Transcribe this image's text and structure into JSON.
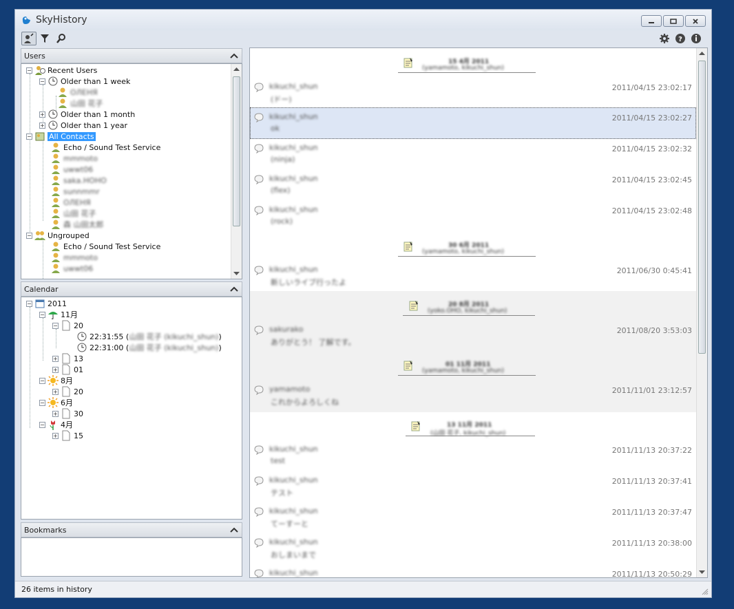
{
  "app": {
    "title": "SkyHistory"
  },
  "users_panel": {
    "title": "Users",
    "tree": {
      "recent": "Recent Users",
      "older_week": "Older than 1 week",
      "week_users": [
        "ОЛЕНЯ",
        "山田 花子"
      ],
      "older_month": "Older than 1 month",
      "older_year": "Older than 1 year",
      "all_contacts": "All Contacts",
      "contacts": [
        "Echo / Sound Test Service",
        "mmmoto",
        "uwwt06",
        "saka.HOHO",
        "sunnmmr",
        "ОЛЕНЯ",
        "山田 花子",
        "森 山田太郎"
      ],
      "ungrouped": "Ungrouped",
      "ungrouped_contacts": [
        "Echo / Sound Test Service",
        "mmmoto",
        "uwwt06"
      ]
    }
  },
  "calendar_panel": {
    "title": "Calendar",
    "year": "2011",
    "nov": "11月",
    "d20": "20",
    "t1": "22:31:55 (",
    "t1_blur": "山田 花子 (kikuchi_shun)",
    "t1_end": ")",
    "t2": "22:31:00 (",
    "t2_blur": "山田 花子 (kikuchi_shun)",
    "t2_end": ")",
    "d13": "13",
    "d01": "01",
    "aug": "8月",
    "aug20": "20",
    "jun": "6月",
    "jun30": "30",
    "apr": "4月",
    "apr15": "15"
  },
  "bookmarks_panel": {
    "title": "Bookmarks"
  },
  "status": {
    "text": "26 items in history"
  },
  "chat": {
    "sessions": [
      {
        "date": "15 4月 2011",
        "people": "(yamamoto, kikuchi_shun)"
      },
      {
        "date": "30 6月 2011",
        "people": "(yamamoto, kikuchi_shun)"
      },
      {
        "date": "20 8月 2011",
        "people": "(yoko.OHO, kikuchi_shun)"
      },
      {
        "date": "01 11月 2011",
        "people": "(yamamoto, kikuchi_shun)"
      },
      {
        "date": "13 11月 2011",
        "people": "(山田 花子, kikuchi_shun)"
      }
    ],
    "messages": [
      {
        "sender": "kikuchi_shun",
        "text": "(ドー)",
        "time": "2011/04/15 23:02:17"
      },
      {
        "sender": "kikuchi_shun",
        "text": "ok",
        "time": "2011/04/15 23:02:27"
      },
      {
        "sender": "kikuchi_shun",
        "text": "(ninja)",
        "time": "2011/04/15 23:02:32"
      },
      {
        "sender": "kikuchi_shun",
        "text": "(flex)",
        "time": "2011/04/15 23:02:45"
      },
      {
        "sender": "kikuchi_shun",
        "text": "(rock)",
        "time": "2011/04/15 23:02:48"
      },
      {
        "sender": "kikuchi_shun",
        "text": "新しいライブ行ったよ",
        "time": "2011/06/30 0:45:41"
      },
      {
        "sender": "sakurako",
        "text": "ありがとう！ 了解です。",
        "time": "2011/08/20 3:53:03"
      },
      {
        "sender": "yamamoto",
        "text": "これからよろしくね",
        "time": "2011/11/01 23:12:57"
      },
      {
        "sender": "kikuchi_shun",
        "text": "test",
        "time": "2011/11/13 20:37:22"
      },
      {
        "sender": "kikuchi_shun",
        "text": "テスト",
        "time": "2011/11/13 20:37:41"
      },
      {
        "sender": "kikuchi_shun",
        "text": "てーすーと",
        "time": "2011/11/13 20:37:47"
      },
      {
        "sender": "kikuchi_shun",
        "text": "おしまいまで",
        "time": "2011/11/13 20:38:00"
      },
      {
        "sender": "kikuchi_shun",
        "text": "",
        "time": "2011/11/13 20:50:29"
      }
    ]
  },
  "colors": {
    "selection": "#3399ff",
    "selected_row": "#dde6f5",
    "background": "#123d75"
  }
}
